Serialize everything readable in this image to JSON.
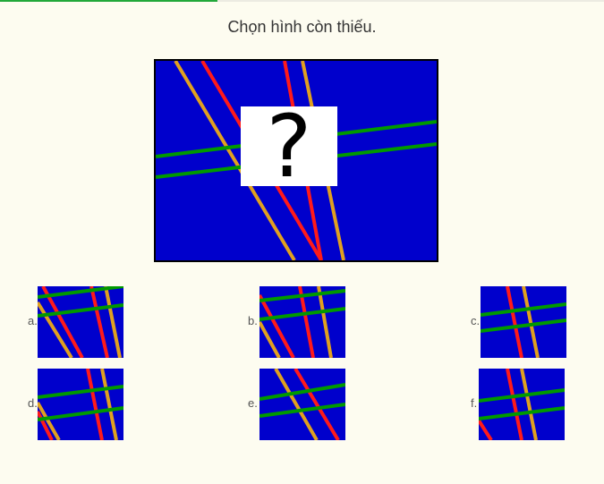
{
  "progress": 0.36,
  "question": "Chọn hình còn thiếu.",
  "puzzle": {
    "placeholder": "?"
  },
  "options": [
    {
      "label": "a."
    },
    {
      "label": "b."
    },
    {
      "label": "c."
    },
    {
      "label": "d."
    },
    {
      "label": "e."
    },
    {
      "label": "f."
    }
  ],
  "colors": {
    "background": "#fdfcf0",
    "panel": "#0000cc",
    "red_line": "#ff1a1a",
    "orange_line": "#e0a020",
    "green_line": "#009900",
    "progress": "#22a83a"
  }
}
